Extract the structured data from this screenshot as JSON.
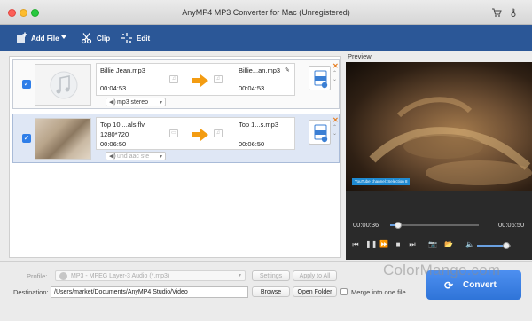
{
  "window": {
    "title": "AnyMP4 MP3 Converter for Mac (Unregistered)",
    "right_icons": [
      "cart-icon",
      "key-icon"
    ]
  },
  "toolbar": {
    "add_file_label": "Add File",
    "clip_label": "Clip",
    "edit_label": "Edit"
  },
  "files": [
    {
      "source_name": "Billie Jean.mp3",
      "source_duration": "00:04:53",
      "output_name": "Billie...an.mp3",
      "output_duration": "00:04:53",
      "audio_track": "mp3 stereo",
      "has_thumbnail": false,
      "selected": false,
      "checked": true
    },
    {
      "source_name": "Top 10 ...als.flv",
      "source_resolution": "1280*720",
      "source_duration": "00:06:50",
      "output_name": "Top 1...s.mp3",
      "output_duration": "00:06:50",
      "audio_track": "und aac ste",
      "has_thumbnail": true,
      "selected": true,
      "checked": true
    }
  ],
  "preview": {
    "label": "Preview",
    "video_tag": "YouTube channel: Selection 8",
    "current_time": "00:00:36",
    "total_time": "00:06:50",
    "progress": 0.088,
    "volume": 0.88
  },
  "bottom": {
    "profile_label": "Profile:",
    "profile_value": "MP3 - MPEG Layer-3 Audio (*.mp3)",
    "settings_label": "Settings",
    "apply_all_label": "Apply to All",
    "destination_label": "Destination:",
    "destination_value": "/Users/market/Documents/AnyMP4 Studio/Video",
    "browse_label": "Browse",
    "open_folder_label": "Open Folder",
    "merge_label": "Merge into one file",
    "convert_label": "Convert"
  },
  "watermark": "ColorMango.com",
  "colors": {
    "toolbar": "#2b5797",
    "accent": "#2f7ee8",
    "arrow": "#f39c12",
    "convert": "#3b80e0"
  }
}
